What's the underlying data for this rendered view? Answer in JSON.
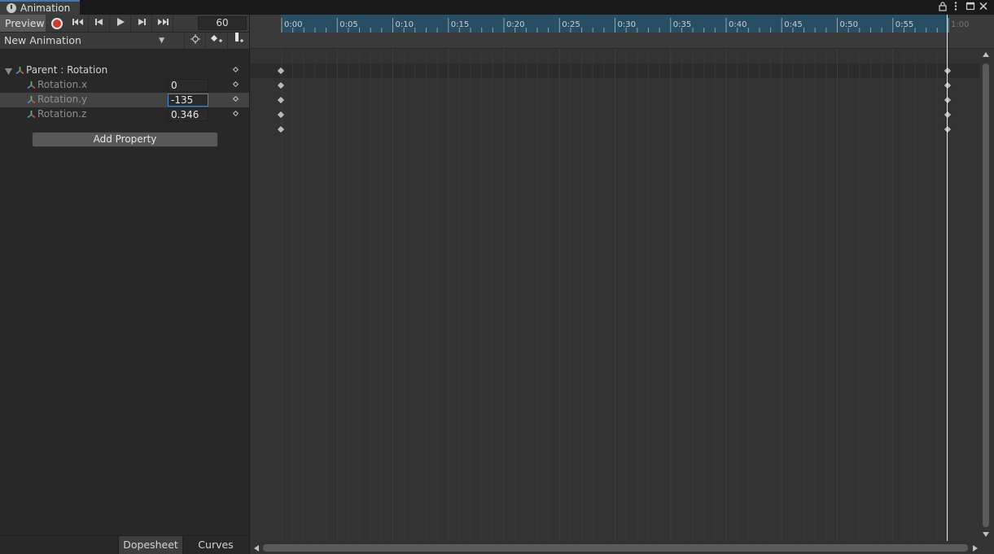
{
  "window": {
    "tab_title": "Animation",
    "lock_icon": "lock-icon",
    "more_icon": "kebab-menu-icon",
    "maximize_icon": "maximize-icon",
    "close_icon": "close-icon"
  },
  "toolbar": {
    "preview_label": "Preview",
    "record_icon": "record-icon",
    "first_key_icon": "skip-to-start-icon",
    "prev_key_icon": "previous-frame-icon",
    "play_icon": "play-icon",
    "next_key_icon": "next-frame-icon",
    "last_key_icon": "skip-to-end-icon",
    "frame_value": "60"
  },
  "clip": {
    "selected": "New Animation",
    "filter_icon": "filter-by-selection-icon",
    "add_keyframe_icon": "add-keyframe-icon",
    "add_event_icon": "add-event-icon"
  },
  "properties": {
    "group_label": "Parent : Rotation",
    "rows": [
      {
        "label": "Rotation.x",
        "value": "0"
      },
      {
        "label": "Rotation.y",
        "value": "-135"
      },
      {
        "label": "Rotation.z",
        "value": "0.346"
      }
    ],
    "add_property_label": "Add Property"
  },
  "bottom_tabs": {
    "dopesheet": "Dopesheet",
    "curves": "Curves"
  },
  "timeline": {
    "ticks": [
      "0:00",
      "0:05",
      "0:10",
      "0:15",
      "0:20",
      "0:25",
      "0:30",
      "0:35",
      "0:40",
      "0:45",
      "0:50",
      "0:55",
      "1:00"
    ],
    "playhead_time": "1:00",
    "keyframe_times": [
      "0:00",
      "1:00"
    ],
    "accent_color": "#274e63"
  }
}
